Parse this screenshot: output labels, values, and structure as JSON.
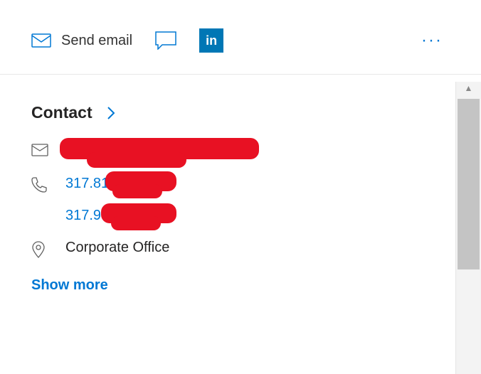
{
  "toolbar": {
    "send_email_label": "Send email"
  },
  "contact": {
    "section_title": "Contact",
    "email": "[redacted]",
    "phone1": "317.81",
    "phone2": "317.9",
    "location": "Corporate Office",
    "show_more_label": "Show more"
  },
  "colors": {
    "accent": "#0078d4",
    "linkedin": "#0077B5",
    "redaction": "#e81123"
  }
}
